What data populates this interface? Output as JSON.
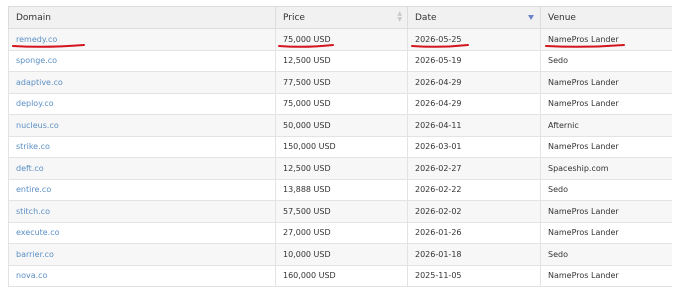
{
  "columns": {
    "domain": "Domain",
    "price": "Price",
    "date": "Date",
    "venue": "Venue"
  },
  "rows": [
    {
      "domain": "remedy.co",
      "price": "75,000 USD",
      "date": "2026-05-25",
      "venue": "NamePros Lander"
    },
    {
      "domain": "sponge.co",
      "price": "12,500 USD",
      "date": "2026-05-19",
      "venue": "Sedo"
    },
    {
      "domain": "adaptive.co",
      "price": "77,500 USD",
      "date": "2026-04-29",
      "venue": "NamePros Lander"
    },
    {
      "domain": "deploy.co",
      "price": "75,000 USD",
      "date": "2026-04-29",
      "venue": "NamePros Lander"
    },
    {
      "domain": "nucleus.co",
      "price": "50,000 USD",
      "date": "2026-04-11",
      "venue": "Afternic"
    },
    {
      "domain": "strike.co",
      "price": "150,000 USD",
      "date": "2026-03-01",
      "venue": "NamePros Lander"
    },
    {
      "domain": "deft.co",
      "price": "12,500 USD",
      "date": "2026-02-27",
      "venue": "Spaceship.com"
    },
    {
      "domain": "entire.co",
      "price": "13,888 USD",
      "date": "2026-02-22",
      "venue": "Sedo"
    },
    {
      "domain": "stitch.co",
      "price": "57,500 USD",
      "date": "2026-02-02",
      "venue": "NamePros Lander"
    },
    {
      "domain": "execute.co",
      "price": "27,000 USD",
      "date": "2026-01-26",
      "venue": "NamePros Lander"
    },
    {
      "domain": "barrier.co",
      "price": "10,000 USD",
      "date": "2026-01-18",
      "venue": "Sedo"
    },
    {
      "domain": "nova.co",
      "price": "160,000 USD",
      "date": "2025-11-05",
      "venue": "NamePros Lander"
    }
  ],
  "colors": {
    "link": "#5b8fc5",
    "annotation": "#d4141e",
    "sort_active": "#6b83c9"
  },
  "icons": {
    "price_sort": "sort-both-icon",
    "date_sort": "sort-desc-icon"
  }
}
